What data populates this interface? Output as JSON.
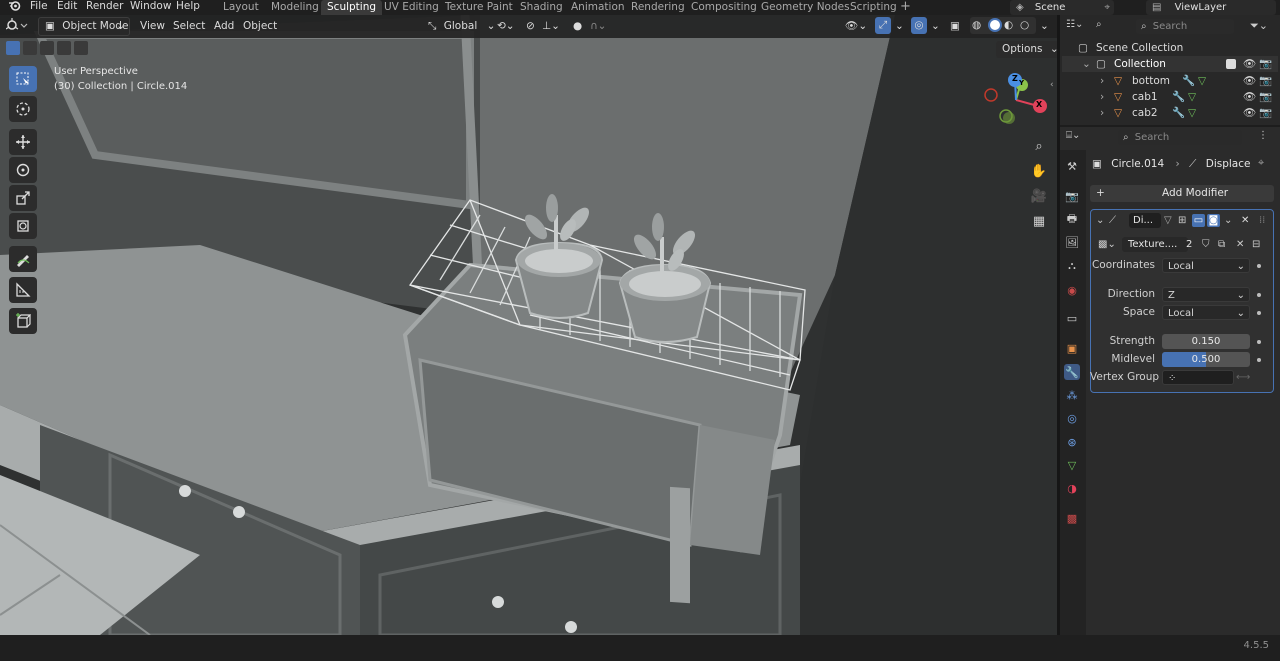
{
  "colors": {
    "accent": "#4772b3",
    "modifier_orange": "#e6914a",
    "object_green": "#6fbf5b",
    "axis_x": "#e2425a",
    "axis_y": "#8bc34a",
    "axis_z": "#4a8fe2"
  },
  "menubar": {
    "items": [
      "File",
      "Edit",
      "Render",
      "Window",
      "Help"
    ]
  },
  "workspaces": {
    "tabs": [
      "Layout",
      "Modeling",
      "Sculpting",
      "UV Editing",
      "Texture Paint",
      "Shading",
      "Animation",
      "Rendering",
      "Compositing",
      "Geometry Nodes",
      "Scripting"
    ],
    "active": "Sculpting",
    "add_icon": "plus-icon"
  },
  "scene": {
    "label": "Scene",
    "icon": "scene-icon"
  },
  "view_layer": {
    "label": "ViewLayer",
    "icon": "view-layer-icon"
  },
  "viewport_header": {
    "mode": "Object Mode",
    "menus": [
      "View",
      "Select",
      "Add",
      "Object"
    ],
    "transform_orientation": "Global",
    "options_label": "Options"
  },
  "viewport_overlay": {
    "view_name": "User Perspective",
    "context_line": "(30) Collection | Circle.014"
  },
  "gizmo": {
    "x": "X",
    "y": "Y",
    "z": "Z"
  },
  "toolbar_icons": [
    "select-box-icon",
    "cursor-icon",
    "move-icon",
    "rotate-icon",
    "scale-icon",
    "transform-icon",
    "annotate-icon",
    "measure-icon",
    "add-cube-icon"
  ],
  "outliner": {
    "search_placeholder": "Search",
    "root": "Scene Collection",
    "collection": "Collection",
    "objects": [
      {
        "name": "bottom"
      },
      {
        "name": "cab1"
      },
      {
        "name": "cab2"
      }
    ]
  },
  "properties": {
    "search_placeholder": "Search",
    "object_name": "Circle.014",
    "modifier_name": "Displace",
    "add_modifier_label": "Add Modifier",
    "modifier_short": "Di...",
    "texture_name": "Texture....",
    "texture_users": "2",
    "rows": {
      "coordinates": {
        "label": "Coordinates",
        "value": "Local"
      },
      "direction": {
        "label": "Direction",
        "value": "Z"
      },
      "space": {
        "label": "Space",
        "value": "Local"
      },
      "strength": {
        "label": "Strength",
        "value": "0.150"
      },
      "midlevel": {
        "label": "Midlevel",
        "value": "0.500",
        "fill": 0.5
      },
      "vertex_group": {
        "label": "Vertex Group",
        "value": ""
      }
    }
  },
  "status": {
    "version": "4.5.5"
  }
}
